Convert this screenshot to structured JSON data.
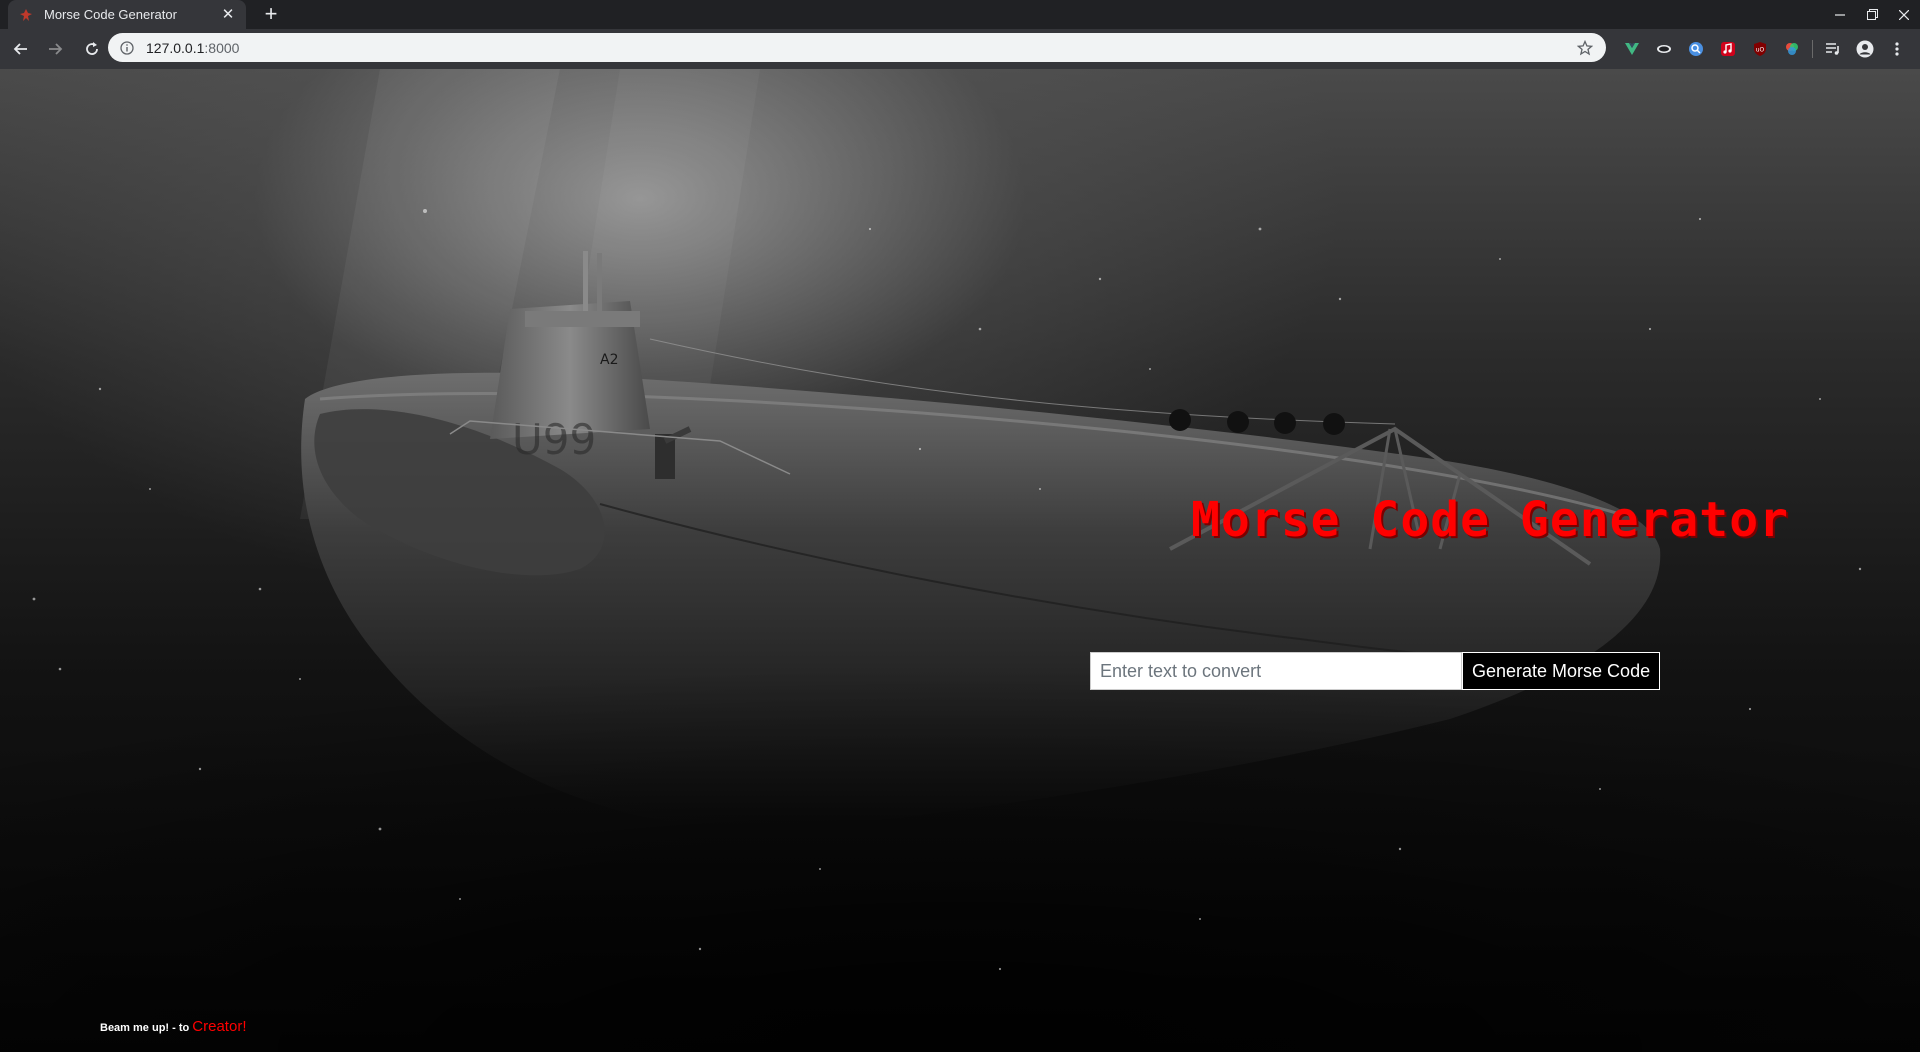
{
  "browser": {
    "tab_title": "Morse Code Generator",
    "url_host": "127.0.0.1",
    "url_port": ":8000",
    "new_tab_symbol": "+",
    "close_symbol": "✕",
    "extension_icons": [
      "vue-devtools-icon",
      "ink-extension-icon",
      "search-extension-icon",
      "music-extension-icon",
      "ublock-icon",
      "color-picker-icon"
    ],
    "accent_colors": {
      "tabbar": "#202124",
      "toolbar": "#35363a",
      "omnibox": "#f1f3f4"
    }
  },
  "page": {
    "title": "Morse Code Generator",
    "input_placeholder": "Enter text to convert",
    "input_value": "",
    "button_label": "Generate Morse Code",
    "footer_text": "Beam me up! - to ",
    "footer_link": "Creator!",
    "title_color": "#ff0000"
  }
}
